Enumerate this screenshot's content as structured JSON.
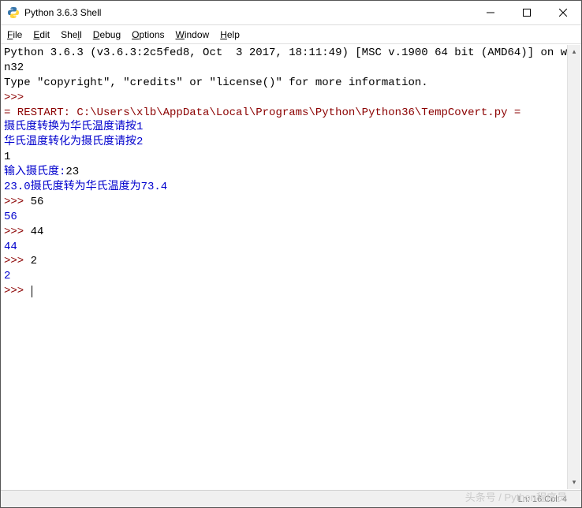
{
  "window": {
    "title": "Python 3.6.3 Shell"
  },
  "menu": {
    "file": "File",
    "edit": "Edit",
    "shell": "Shell",
    "debug": "Debug",
    "options": "Options",
    "window": "Window",
    "help": "Help"
  },
  "console": {
    "header1": "Python 3.6.3 (v3.6.3:2c5fed8, Oct  3 2017, 18:11:49) [MSC v.1900 64 bit (AMD64)] on win32",
    "header2": "Type \"copyright\", \"credits\" or \"license()\" for more information.",
    "prompt": ">>> ",
    "restart": "= RESTART: C:\\Users\\xlb\\AppData\\Local\\Programs\\Python\\Python36\\TempCovert.py =",
    "line_c2f": "摄氏度转换为华氏温度请按1",
    "line_f2c": "华氏温度转化为摄氏度请按2",
    "input_choice": "1",
    "prompt_celsius": "输入摄氏度:",
    "input_celsius": "23",
    "result": "23.0摄氏度转为华氏温度为73.4",
    "echo1_in": "56",
    "echo1_out": "56",
    "echo2_in": "44",
    "echo2_out": "44",
    "echo3_in": "2",
    "echo3_out": "2"
  },
  "status": {
    "position": "Ln: 16   Col: 4"
  },
  "watermark": "头条号 / Python程序员"
}
